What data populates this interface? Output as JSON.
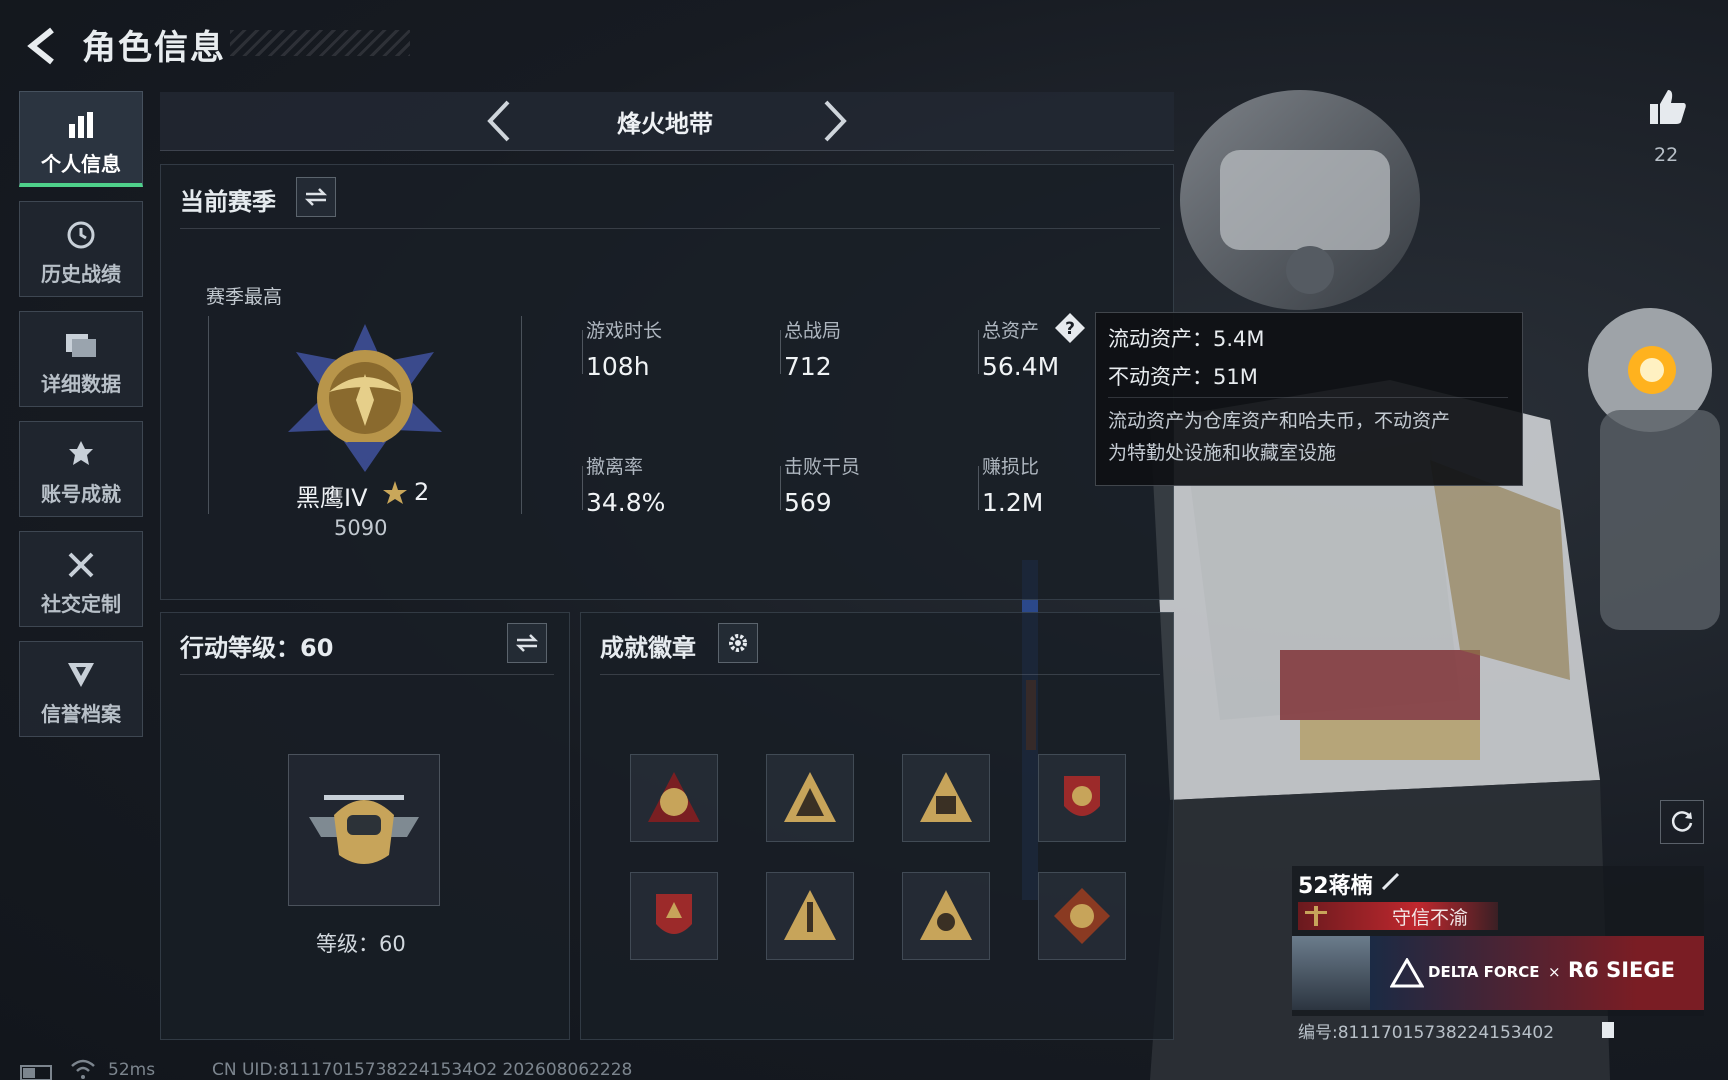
{
  "header": {
    "title": "角色信息"
  },
  "sidebar": {
    "items": [
      {
        "label": "个人信息",
        "icon": "bar-chart-icon",
        "active": true
      },
      {
        "label": "历史战绩",
        "icon": "history-clock-icon",
        "active": false
      },
      {
        "label": "详细数据",
        "icon": "folder-icon",
        "active": false
      },
      {
        "label": "账号成就",
        "icon": "medal-icon",
        "active": false
      },
      {
        "label": "社交定制",
        "icon": "wrench-screwdriver-icon",
        "active": false
      },
      {
        "label": "信誉档案",
        "icon": "shield-emblem-icon",
        "active": false
      }
    ]
  },
  "mode_selector": {
    "label": "烽火地带"
  },
  "season": {
    "header": "当前赛季",
    "best_label": "赛季最高",
    "rank_name": "黑鹰IV",
    "rank_stars": "2",
    "rank_score": "5090",
    "stats": [
      {
        "label": "游戏时长",
        "value": "108h"
      },
      {
        "label": "总战局",
        "value": "712"
      },
      {
        "label": "总资产",
        "value": "56.4M"
      },
      {
        "label": "撤离率",
        "value": "34.8%"
      },
      {
        "label": "击败干员",
        "value": "569"
      },
      {
        "label": "赚损比",
        "value": "1.2M"
      }
    ]
  },
  "tooltip": {
    "liquid": "流动资产：5.4M",
    "fixed": "不动资产：51M",
    "desc_line1": "流动资产为仓库资产和哈夫币，不动资产",
    "desc_line2": "为特勤处设施和收藏室设施"
  },
  "action_level": {
    "header": "行动等级：60",
    "level_text": "等级：60"
  },
  "achievements": {
    "header": "成就徽章",
    "badges": [
      "badge-1",
      "badge-2",
      "badge-3",
      "badge-4",
      "badge-5",
      "badge-6",
      "badge-7",
      "badge-8"
    ]
  },
  "likes": {
    "count": "22"
  },
  "player": {
    "name": "52蒋楠",
    "title": "守信不渝",
    "banner_brand": "DELTA FORCE",
    "banner_x": "×",
    "banner_collab": "R6 SIEGE",
    "id_label": "编号:811170157382241534​02"
  },
  "footer": {
    "ping": "52ms",
    "uid": "CN UID:811170157382241534O2 202608062228"
  },
  "colors": {
    "accent_green": "#4fd18b",
    "title_red": "#c0282e"
  }
}
